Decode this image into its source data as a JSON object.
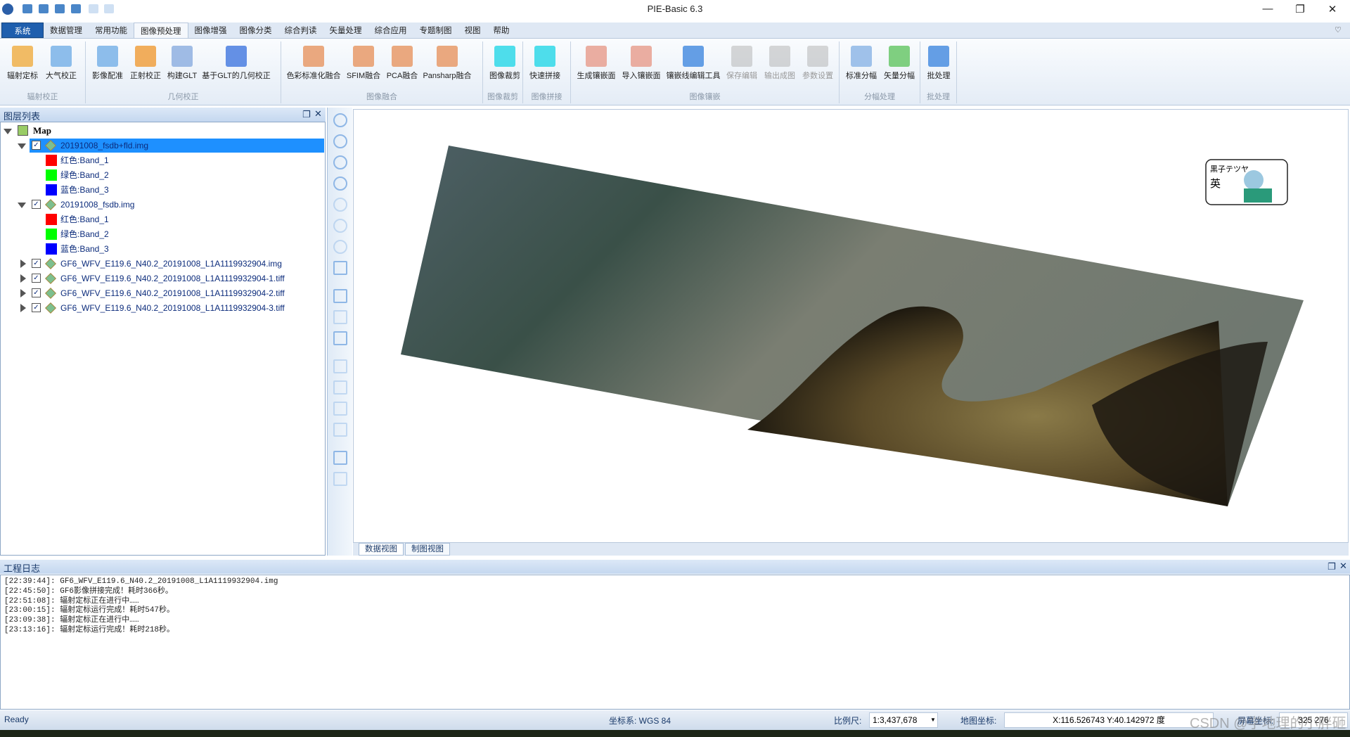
{
  "app": {
    "title": "PIE-Basic 6.3"
  },
  "window_controls": {
    "minimize": "—",
    "restore": "❐",
    "close": "✕"
  },
  "menu_tabs": [
    "系统",
    "数据管理",
    "常用功能",
    "图像预处理",
    "图像增强",
    "图像分类",
    "综合判读",
    "矢量处理",
    "综合应用",
    "专题制图",
    "视图",
    "帮助"
  ],
  "active_tab": "图像预处理",
  "ribbon": {
    "groups": [
      {
        "label": "辐射校正",
        "buttons": [
          "辐射定标",
          "大气校正"
        ]
      },
      {
        "label": "几何校正",
        "buttons": [
          "影像配准",
          "正射校正",
          "构建GLT",
          "基于GLT的几何校正"
        ]
      },
      {
        "label": "图像融合",
        "buttons": [
          "色彩标准化融合",
          "SFIM融合",
          "PCA融合",
          "Pansharp融合"
        ]
      },
      {
        "label": "图像裁剪",
        "buttons": [
          "图像裁剪"
        ]
      },
      {
        "label": "图像拼接",
        "buttons": [
          "快速拼接"
        ]
      },
      {
        "label": "图像镶嵌",
        "buttons": [
          "生成镶嵌面",
          "导入镶嵌面",
          "镶嵌线编辑工具",
          "保存编辑",
          "输出成图",
          "参数设置"
        ]
      },
      {
        "label": "分幅处理",
        "buttons": [
          "标准分幅",
          "矢量分幅"
        ]
      },
      {
        "label": "批处理",
        "buttons": [
          "批处理"
        ]
      }
    ]
  },
  "layer_panel": {
    "title": "图层列表",
    "root": "Map",
    "layers": [
      {
        "name": "20191008_fsdb+fld.img",
        "selected": true,
        "expanded": true,
        "bands": [
          "红色:Band_1",
          "绿色:Band_2",
          "蓝色:Band_3"
        ]
      },
      {
        "name": "20191008_fsdb.img",
        "expanded": true,
        "bands": [
          "红色:Band_1",
          "绿色:Band_2",
          "蓝色:Band_3"
        ]
      },
      {
        "name": "GF6_WFV_E119.6_N40.2_20191008_L1A1119932904.img"
      },
      {
        "name": "GF6_WFV_E119.6_N40.2_20191008_L1A1119932904-1.tiff"
      },
      {
        "name": "GF6_WFV_E119.6_N40.2_20191008_L1A1119932904-2.tiff"
      },
      {
        "name": "GF6_WFV_E119.6_N40.2_20191008_L1A1119932904-3.tiff"
      }
    ],
    "band_colors": [
      "#ff0000",
      "#00ff00",
      "#0000ff"
    ]
  },
  "map_tabs": [
    "数据视图",
    "制图视图"
  ],
  "sticker_text": {
    "line1": "黒子テツヤ",
    "line2": "英"
  },
  "log": {
    "title": "工程日志",
    "lines": [
      "[22:39:44]: GF6_WFV_E119.6_N40.2_20191008_L1A1119932904.img",
      "[22:45:50]: GF6影像拼接完成！耗时366秒。",
      "[22:51:08]: 辐射定标正在进行中……",
      "[23:00:15]: 辐射定标运行完成！耗时547秒。",
      "[23:09:38]: 辐射定标正在进行中……",
      "[23:13:16]: 辐射定标运行完成！耗时218秒。"
    ]
  },
  "status": {
    "ready": "Ready",
    "crs": "坐标系: WGS 84",
    "scale_label": "比例尺:",
    "scale_value": "1:3,437,678",
    "map_coord_label": "地图坐标:",
    "map_coord_value": "X:116.526743 Y:40.142972 度",
    "screen_coord_label": "屏幕坐标:",
    "screen_coord_value": "325 276"
  },
  "watermark": "CSDN @学地理的小胖砸"
}
